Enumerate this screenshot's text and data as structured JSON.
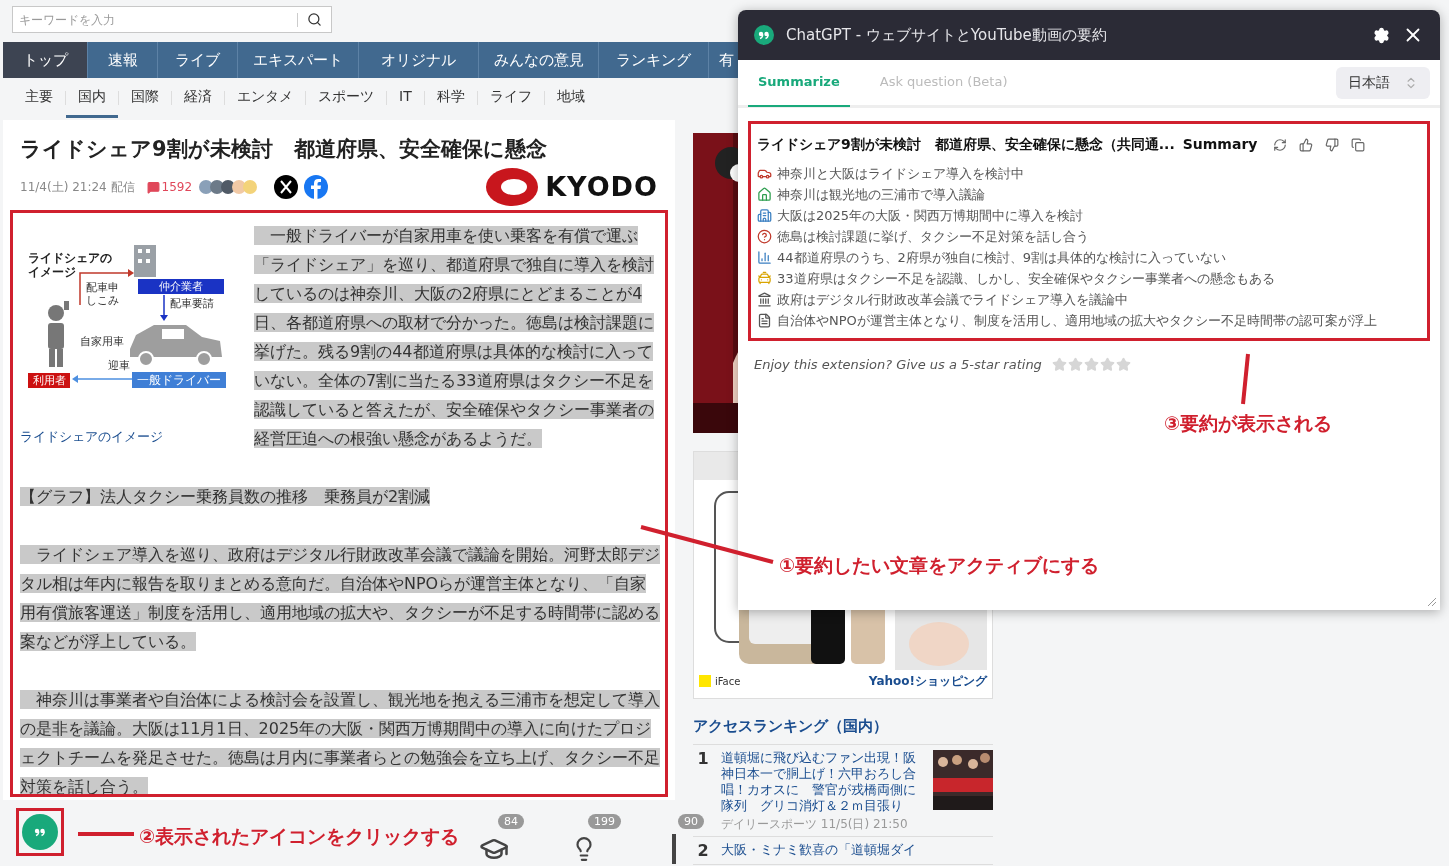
{
  "search": {
    "placeholder": "キーワードを入力"
  },
  "nav": [
    {
      "label": "トップ",
      "selected": true
    },
    {
      "label": "速報",
      "selected": false
    },
    {
      "label": "ライブ",
      "selected": false
    },
    {
      "label": "エキスパート",
      "selected": false
    },
    {
      "label": "オリジナル",
      "selected": false
    },
    {
      "label": "みんなの意見",
      "selected": false
    },
    {
      "label": "ランキング",
      "selected": false
    },
    {
      "label": "有",
      "selected": false
    }
  ],
  "subnav": [
    {
      "label": "主要",
      "selected": false
    },
    {
      "label": "国内",
      "selected": true
    },
    {
      "label": "国際",
      "selected": false
    },
    {
      "label": "経済",
      "selected": false
    },
    {
      "label": "エンタメ",
      "selected": false
    },
    {
      "label": "スポーツ",
      "selected": false
    },
    {
      "label": "IT",
      "selected": false
    },
    {
      "label": "科学",
      "selected": false
    },
    {
      "label": "ライフ",
      "selected": false
    },
    {
      "label": "地域",
      "selected": false
    }
  ],
  "article": {
    "title": "ライドシェア9割が未検討　都道府県、安全確保に懸念",
    "date": "11/4(土) 21:24 配信",
    "comments": "1592",
    "source_logo": "KYODO",
    "figure": {
      "nodes": [
        {
          "kind": "heading",
          "text": "ライドシェアのイメージ"
        },
        {
          "kind": "broker",
          "text": "仲介業者"
        },
        {
          "kind": "request",
          "text": "配車申しこみ"
        },
        {
          "kind": "dispatch",
          "text": "配車要請"
        },
        {
          "kind": "car",
          "text": "自家用車"
        },
        {
          "kind": "user",
          "text": "利用者"
        },
        {
          "kind": "pickup",
          "text": "迎車"
        },
        {
          "kind": "driver",
          "text": "一般ドライバー"
        }
      ],
      "caption": "ライドシェアのイメージ"
    },
    "blocks": [
      {
        "kind": "paragraph",
        "selected": true,
        "text": "　一般ドライバーが自家用車を使い乗客を有償で運ぶ「ライドシェア」を巡り、都道府県で独自に導入を検討しているのは神奈川、大阪の2府県にとどまることが4日、各都道府県への取材で分かった。徳島は検討課題に挙げた。残る9割の44都道府県は具体的な検討に入っていない。全体の7割に当たる33道府県はタクシー不足を認識していると答えたが、安全確保やタクシー事業者の経営圧迫への根強い懸念があるようだ。"
      },
      {
        "kind": "link",
        "selected": true,
        "text": "【グラフ】法人タクシー乗務員数の推移　乗務員が2割減"
      },
      {
        "kind": "paragraph",
        "selected": true,
        "text": "　ライドシェア導入を巡り、政府はデジタル行財政改革会議で議論を開始。河野太郎デジタル相は年内に報告を取りまとめる意向だ。自治体やNPOらが運営主体となり、「自家用有償旅客運送」制度を活用し、適用地域の拡大や、タクシーが不足する時間帯に認める案などが浮上している。"
      },
      {
        "kind": "paragraph",
        "selected": true,
        "text": "　神奈川は事業者や自治体による検討会を設置し、観光地を抱える三浦市を想定して導入の是非を議論。大阪は11月1日、2025年の大阪・関西万博期間中の導入に向けたプロジェクトチームを発足させた。徳島は月内に事業者らとの勉強会を立ち上げ、タクシー不足対策を話し合う。"
      }
    ]
  },
  "reactions": [
    {
      "kind": "cap",
      "count": "84"
    },
    {
      "kind": "bulb",
      "count": "199"
    },
    {
      "kind": "bar",
      "count": "90"
    }
  ],
  "ad": {
    "brand": "iFace",
    "link": "Yahoo!ショッピング"
  },
  "ranking": {
    "title": "アクセスランキング（国内）",
    "items": [
      {
        "rank": "1",
        "title": "道頓堀に飛び込むファン出現！阪神日本一で胴上げ！六甲おろし合唱！カオスに　警官が戎橋両側に隊列　グリコ消灯＆２ｍ目張り",
        "source": "デイリースポーツ 11/5(日) 21:50"
      },
      {
        "rank": "2",
        "title": "大阪・ミナミ歓喜の「道頓堀ダイ"
      }
    ]
  },
  "extension": {
    "title": "ChatGPT - ウェブサイトとYouTube動画の要約",
    "tabs": [
      {
        "label": "Summarize",
        "selected": true
      },
      {
        "label": "Ask question (Beta)",
        "selected": false
      }
    ],
    "language": "日本語",
    "summary_title": "ライドシェア9割が未検討　都道府県、安全確保に懸念（共同通...",
    "summary_label": "Summary",
    "points": [
      {
        "kind": "car",
        "text": "神奈川と大阪はライドシェア導入を検討中"
      },
      {
        "kind": "house",
        "text": "神奈川は観光地の三浦市で導入議論"
      },
      {
        "kind": "building",
        "text": "大阪は2025年の大阪・関西万博期間中に導入を検討"
      },
      {
        "kind": "question",
        "text": "徳島は検討課題に挙げ、タクシー不足対策を話し合う"
      },
      {
        "kind": "chart",
        "text": "44都道府県のうち、2府県が独自に検討、9割は具体的な検討に入っていない"
      },
      {
        "kind": "taxi",
        "text": "33道府県はタクシー不足を認識、しかし、安全確保やタクシー事業者への懸念もある"
      },
      {
        "kind": "bank",
        "text": "政府はデジタル行財政改革会議でライドシェア導入を議論中"
      },
      {
        "kind": "memo",
        "text": "自治体やNPOが運営主体となり、制度を活用し、適用地域の拡大やタクシー不足時間帯の認可案が浮上"
      }
    ],
    "rating_prompt": "Enjoy this extension? Give us a 5-star rating",
    "stars": 0
  },
  "annotations": [
    {
      "kind": "select",
      "text": "①要約したい文章をアクティブにする"
    },
    {
      "kind": "click",
      "text": "②表示されたアイコンをクリックする"
    },
    {
      "kind": "result",
      "text": "③要約が表示される"
    }
  ]
}
